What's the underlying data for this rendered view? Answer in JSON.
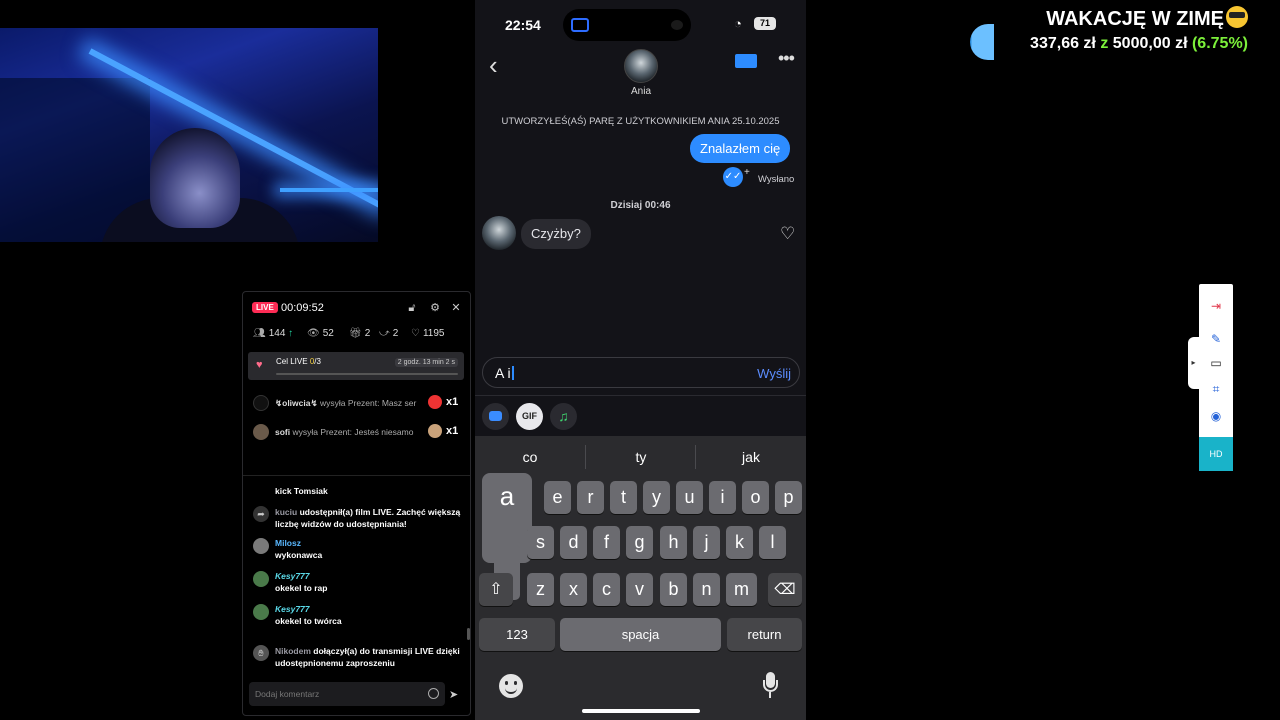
{
  "goal": {
    "title": "WAKACJĘ W ZIMĘ",
    "current": "337,66 zł",
    "connector": "z",
    "target": "5000,00 zł",
    "percent": "(6.75%)",
    "progress_fraction": 0.0675,
    "accent_color": "#7cf03a"
  },
  "live_panel": {
    "badge": "LIVE",
    "timer": "00:09:52",
    "icons": [
      "lock-icon",
      "settings-icon",
      "close-icon"
    ],
    "stats": {
      "followers": "144",
      "viewers": "52",
      "gifts": "2",
      "shares": "2",
      "likes": "1195"
    },
    "goal": {
      "label": "Cel LIVE",
      "progress": "0",
      "total": "/3",
      "time": "2 godz. 13 min 2 s"
    },
    "gifts": [
      {
        "name": "↯oliwcia↯",
        "text": "wysyła Prezent: Masz ser",
        "count": "x1"
      },
      {
        "name": "sofi",
        "text": "wysyła Prezent: Jesteś niesamo",
        "count": "x1"
      }
    ],
    "chat": [
      {
        "name": "",
        "message": "kick Tomsiak"
      },
      {
        "name": "kuciu",
        "message": "udostępnił(a) film LIVE. Zachęć większą liczbę widzów do udostępniania!"
      },
      {
        "name": "Milosz",
        "message": "wykonawca"
      },
      {
        "name": "Kesy777",
        "message": "okekel to rap"
      },
      {
        "name": "Kesy777",
        "message": "okekel to twórca"
      },
      {
        "name": "Nikodem",
        "message": "dołączył(a) do transmisji LIVE dzięki udostępnionemu zaproszeniu"
      }
    ],
    "input_placeholder": "Dodaj komentarz"
  },
  "phone": {
    "status": {
      "time": "22:54",
      "battery": "71"
    },
    "contact": {
      "name": "Ania"
    },
    "pair_notice": "UTWORZYŁEŚ(AŚ) PARĘ Z UŻYTKOWNIKIEM ANIA 25.10.2025",
    "sent_message": "Znalazłem cię",
    "sent_status": "Wysłano",
    "day_stamp": "Dzisiaj 00:46",
    "received_message": "Czyżby?",
    "compose": {
      "value": "A i",
      "send_label": "Wyślij"
    },
    "tools": {
      "gif": "GIF"
    },
    "keyboard": {
      "suggestions": [
        "co",
        "ty",
        "jak"
      ],
      "row1": [
        "e",
        "r",
        "t",
        "y",
        "u",
        "i",
        "o",
        "p"
      ],
      "row2": [
        "s",
        "d",
        "f",
        "g",
        "h",
        "j",
        "k",
        "l"
      ],
      "row3": [
        "z",
        "x",
        "c",
        "v",
        "b",
        "n",
        "m"
      ],
      "popup_key": "a",
      "numbers_label": "123",
      "space_label": "spacja",
      "return_label": "return"
    }
  },
  "right_toolbar": {
    "hd_label": "HD"
  }
}
